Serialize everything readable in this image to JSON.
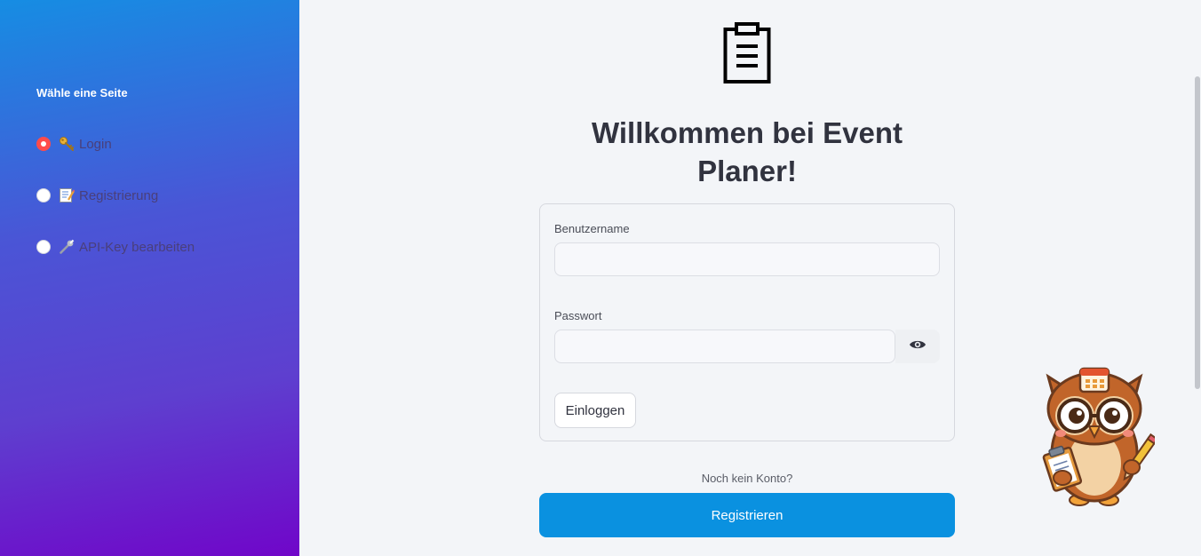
{
  "sidebar": {
    "title": "Wähle eine Seite",
    "items": [
      {
        "label": "Login",
        "icon": "key-icon",
        "selected": true
      },
      {
        "label": "Registrierung",
        "icon": "memo-icon",
        "selected": false
      },
      {
        "label": "API-Key bearbeiten",
        "icon": "wrench-icon",
        "selected": false
      }
    ]
  },
  "main": {
    "header_icon": "clipboard-icon",
    "title_line1": "Willkommen bei Event",
    "title_line2": "Planer!",
    "form": {
      "username_label": "Benutzername",
      "username_value": "",
      "password_label": "Passwort",
      "password_value": "",
      "login_button": "Einloggen"
    },
    "no_account_text": "Noch kein Konto?",
    "register_button": "Registrieren",
    "mascot": "owl-with-clipboard-and-pencil"
  },
  "colors": {
    "accent": "#ff4b4b",
    "register_button": "#0a91e0",
    "sidebar_gradient_start": "#168de3",
    "sidebar_gradient_end": "#7006c9",
    "background": "#f3f5f8"
  }
}
